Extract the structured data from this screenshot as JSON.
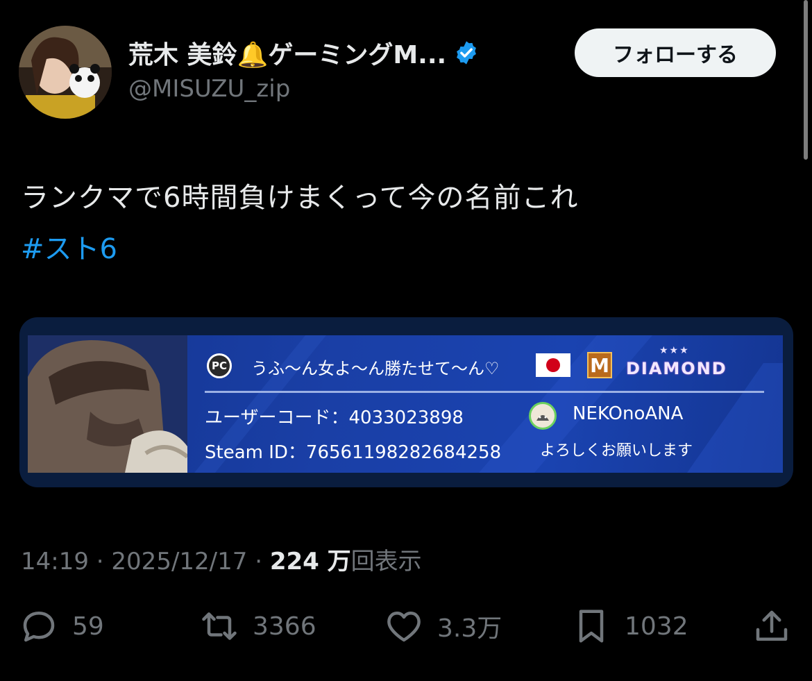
{
  "author": {
    "name": "荒木 美鈴🔔ゲーミングM...",
    "handle": "@MISUZU_zip",
    "follow_label": "フォローする"
  },
  "tweet": {
    "text": "ランクマで6時間負けまくって今の名前これ",
    "hashtag": "#スト6"
  },
  "game_card": {
    "platform_badge": "PC",
    "player_name": "うふ〜ん女よ〜ん勝たせて〜ん♡",
    "rank_letter": "M",
    "rank_name": "DIAMOND",
    "rank_stars": "★★★",
    "user_code_line": "ユーザーコード：4033023898",
    "steam_id_line": "Steam ID：76561198282684258",
    "club_name": "NEKOnoANA",
    "greeting": "よろしくお願いします"
  },
  "meta": {
    "time": "14:19",
    "sep": " · ",
    "date": "2025/12/17",
    "views_count": "224 万",
    "views_label": "回表示"
  },
  "actions": {
    "replies": "59",
    "retweets": "3366",
    "likes": "3.3万",
    "bookmarks": "1032"
  },
  "colors": {
    "background": "#000000",
    "link": "#1d9bf0",
    "muted": "#71767b",
    "verified": "#1d9bf0"
  }
}
